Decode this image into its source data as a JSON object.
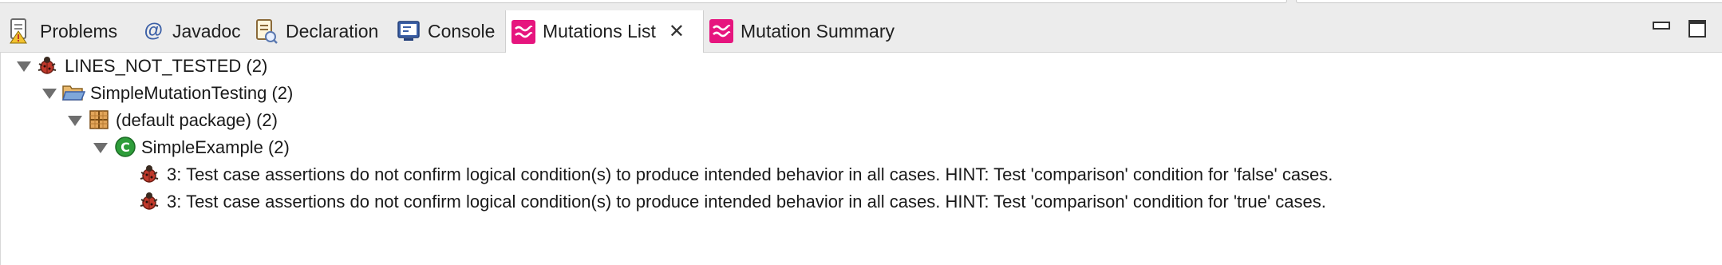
{
  "tabs": [
    {
      "label": "Problems",
      "icon": "problems-icon",
      "active": false
    },
    {
      "label": "Javadoc",
      "icon": "javadoc-icon",
      "active": false
    },
    {
      "label": "Declaration",
      "icon": "declaration-icon",
      "active": false
    },
    {
      "label": "Console",
      "icon": "console-icon",
      "active": false
    },
    {
      "label": "Mutations List",
      "icon": "mutation-icon",
      "active": true,
      "closable": true
    },
    {
      "label": "Mutation Summary",
      "icon": "mutation-icon",
      "active": false
    }
  ],
  "close_symbol": "✕",
  "window_controls": {
    "minimize_icon": "minimize-icon",
    "maximize_icon": "maximize-icon"
  },
  "tree": {
    "root": {
      "label": "LINES_NOT_TESTED (2)",
      "icon": "bug-icon",
      "expanded": true
    },
    "project": {
      "label": "SimpleMutationTesting (2)",
      "icon": "folder-open-icon",
      "expanded": true
    },
    "package": {
      "label": "(default package) (2)",
      "icon": "package-icon",
      "expanded": true
    },
    "class": {
      "label": "SimpleExample (2)",
      "icon": "class-icon",
      "class_badge": "C",
      "expanded": true
    },
    "mutations": [
      {
        "label": "3: Test case assertions do not confirm logical condition(s) to produce intended behavior in all cases. HINT: Test 'comparison' condition for 'false' cases.",
        "icon": "bug-icon"
      },
      {
        "label": "3: Test case assertions do not confirm logical condition(s) to produce intended behavior in all cases. HINT: Test 'comparison' condition for 'true' cases.",
        "icon": "bug-icon"
      }
    ]
  },
  "colors": {
    "mutation_accent": "#e6157e",
    "tab_bar": "#ececec",
    "class_icon": "#2e9d3a"
  }
}
